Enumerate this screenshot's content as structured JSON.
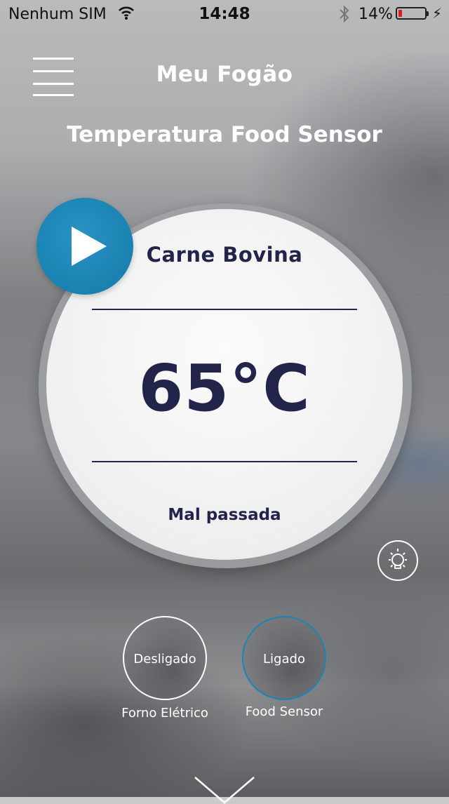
{
  "status_bar": {
    "carrier": "Nenhum SIM",
    "time": "14:48",
    "battery_percent": "14%",
    "battery_level": 0.14,
    "battery_color": "#e21b1b",
    "icons": [
      "wifi-icon",
      "bluetooth-icon",
      "battery-icon",
      "charging-bolt-icon"
    ]
  },
  "header": {
    "menu_icon": "hamburger-menu-icon",
    "title": "Meu Fogão"
  },
  "section": {
    "title": "Temperatura Food Sensor"
  },
  "dial": {
    "meat_type": "Carne Bovina",
    "temperature": "65°C",
    "doneness": "Mal passada",
    "play_icon": "play-icon",
    "accent_color": "#137aa8",
    "text_color": "#22244a"
  },
  "light_button": {
    "icon": "lamp-icon"
  },
  "toggles": [
    {
      "state": "Desligado",
      "label": "Forno Elétrico",
      "border_color": "#ffffff"
    },
    {
      "state": "Ligado",
      "label": "Food Sensor",
      "border_color": "#1a84b8"
    }
  ],
  "footer": {
    "icon": "chevron-down-icon"
  }
}
